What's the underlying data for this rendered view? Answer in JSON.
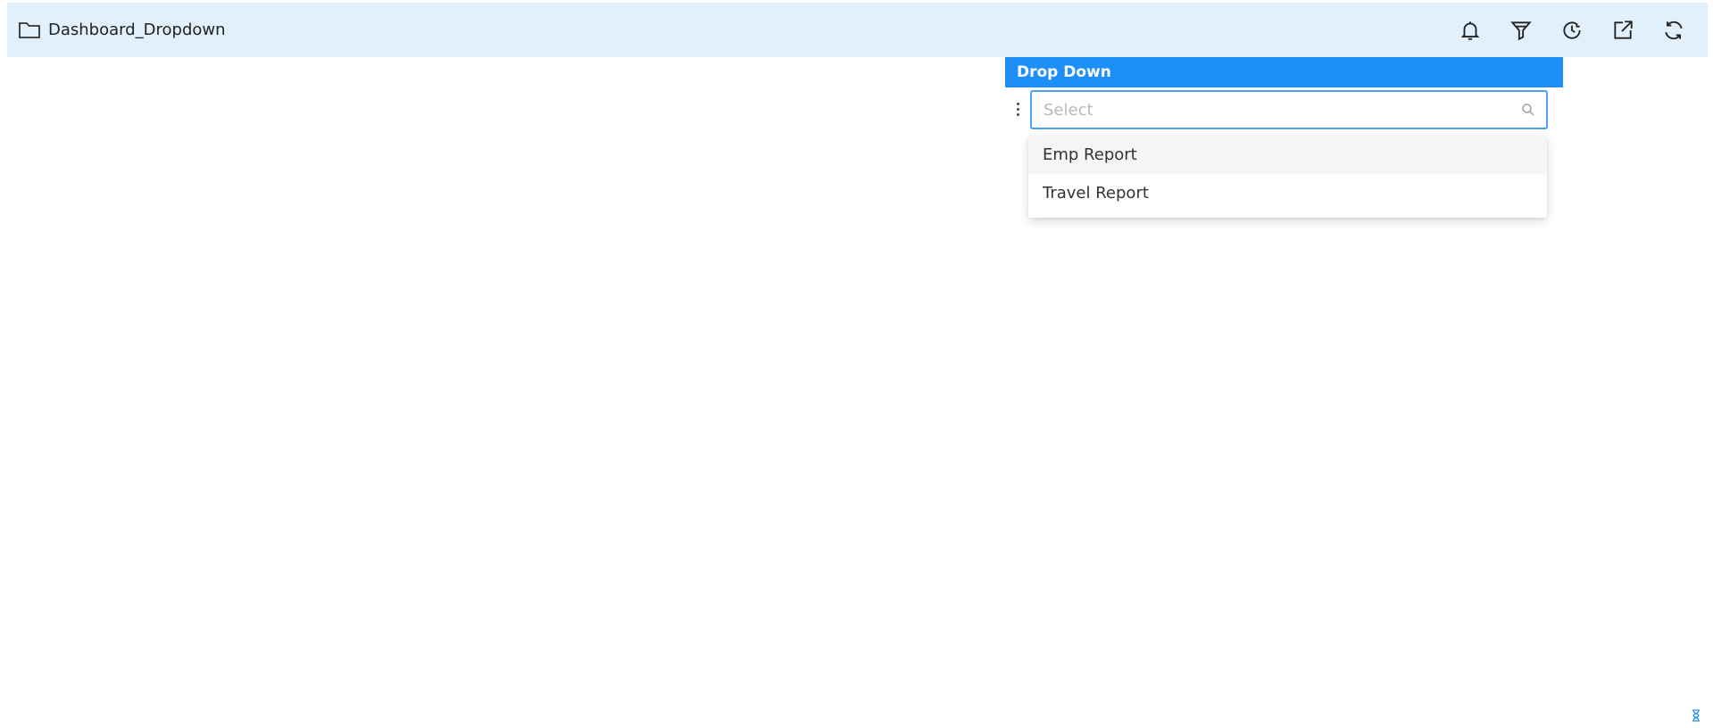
{
  "header": {
    "title": "Dashboard_Dropdown",
    "folder_icon": "folder-icon",
    "actions": [
      {
        "name": "bell-icon"
      },
      {
        "name": "filter-icon"
      },
      {
        "name": "history-icon"
      },
      {
        "name": "external-link-icon"
      },
      {
        "name": "refresh-icon"
      }
    ]
  },
  "widget": {
    "title": "Drop Down",
    "select": {
      "placeholder": "Select",
      "value": ""
    },
    "options": [
      "Emp Report",
      "Travel Report"
    ]
  },
  "colors": {
    "topbar_bg": "#e1f0fa",
    "widget_header": "#1e8ff8",
    "input_border": "#4aa3f2"
  }
}
